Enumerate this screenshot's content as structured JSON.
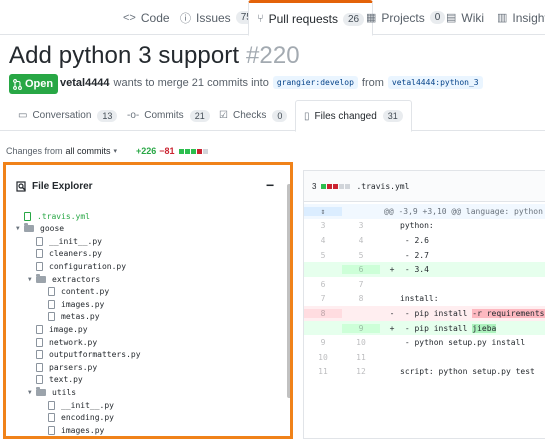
{
  "repo_nav": {
    "items": [
      {
        "icon": "code-icon",
        "glyph": "<>",
        "label": "Code",
        "count": null
      },
      {
        "icon": "issue-icon",
        "glyph": "ⓘ",
        "label": "Issues",
        "count": "75"
      },
      {
        "icon": "pull-request-icon",
        "glyph": "⑂",
        "label": "Pull requests",
        "count": "26"
      },
      {
        "icon": "projects-icon",
        "glyph": "▦",
        "label": "Projects",
        "count": "0"
      },
      {
        "icon": "wiki-icon",
        "glyph": "▤",
        "label": "Wiki",
        "count": null
      },
      {
        "icon": "insights-icon",
        "glyph": "▥",
        "label": "Insights",
        "count": null
      }
    ]
  },
  "pr": {
    "title": "Add python 3 support",
    "number": "#220",
    "state": "Open",
    "state_icon": "pr-open-icon",
    "author": "vetal4444",
    "action_text": "wants to merge 21 commits into",
    "base_branch": "grangier:develop",
    "from_text": "from",
    "head_branch": "vetal4444:python_3"
  },
  "tabs": [
    {
      "icon": "conversation-icon",
      "glyph": "▭",
      "label": "Conversation",
      "count": "13"
    },
    {
      "icon": "commits-icon",
      "glyph": "-o-",
      "label": "Commits",
      "count": "21"
    },
    {
      "icon": "checks-icon",
      "glyph": "☑",
      "label": "Checks",
      "count": "0"
    },
    {
      "icon": "files-changed-icon",
      "glyph": "▯",
      "label": "Files changed",
      "count": "31"
    }
  ],
  "changes": {
    "prefix": "Changes from",
    "selector": "all commits",
    "additions": "+226",
    "deletions": "−81"
  },
  "explorer": {
    "title": "File Explorer",
    "collapse": "−",
    "tree": [
      {
        "type": "file",
        "label": ".travis.yml",
        "depth": 0,
        "active": true
      },
      {
        "type": "folder",
        "label": "goose",
        "depth": 0
      },
      {
        "type": "file",
        "label": "__init__.py",
        "depth": 1
      },
      {
        "type": "file",
        "label": "cleaners.py",
        "depth": 1
      },
      {
        "type": "file",
        "label": "configuration.py",
        "depth": 1
      },
      {
        "type": "folder",
        "label": "extractors",
        "depth": 1
      },
      {
        "type": "file",
        "label": "content.py",
        "depth": 2
      },
      {
        "type": "file",
        "label": "images.py",
        "depth": 2
      },
      {
        "type": "file",
        "label": "metas.py",
        "depth": 2
      },
      {
        "type": "file",
        "label": "image.py",
        "depth": 1
      },
      {
        "type": "file",
        "label": "network.py",
        "depth": 1
      },
      {
        "type": "file",
        "label": "outputformatters.py",
        "depth": 1
      },
      {
        "type": "file",
        "label": "parsers.py",
        "depth": 1
      },
      {
        "type": "file",
        "label": "text.py",
        "depth": 1
      },
      {
        "type": "folder",
        "label": "utils",
        "depth": 1
      },
      {
        "type": "file",
        "label": "__init__.py",
        "depth": 2
      },
      {
        "type": "file",
        "label": "encoding.py",
        "depth": 2
      },
      {
        "type": "file",
        "label": "images.py",
        "depth": 2
      }
    ]
  },
  "diff": {
    "change_count": "3",
    "filename": ".travis.yml",
    "expand_icon": "unfold-icon",
    "lines": [
      {
        "kind": "hunk",
        "old": "",
        "new": "",
        "mark": "",
        "text": "@@ -3,9 +3,10 @@ language: python"
      },
      {
        "kind": "ctx",
        "old": "3",
        "new": "3",
        "mark": "",
        "text": "python:"
      },
      {
        "kind": "ctx",
        "old": "4",
        "new": "4",
        "mark": "",
        "text": "    - 2.6"
      },
      {
        "kind": "ctx",
        "old": "5",
        "new": "5",
        "mark": "",
        "text": "    - 2.7"
      },
      {
        "kind": "add",
        "old": "",
        "new": "6",
        "mark": "+",
        "text": "    - 3.4"
      },
      {
        "kind": "ctx",
        "old": "6",
        "new": "7",
        "mark": "",
        "text": ""
      },
      {
        "kind": "ctx",
        "old": "7",
        "new": "8",
        "mark": "",
        "text": "install:"
      },
      {
        "kind": "del",
        "old": "8",
        "new": "",
        "mark": "-",
        "text": "    - pip install ",
        "hl": "-r requirements.",
        "tail": ""
      },
      {
        "kind": "add",
        "old": "",
        "new": "9",
        "mark": "+",
        "text": "    - pip install ",
        "hl": "jieba",
        "tail": ""
      },
      {
        "kind": "ctx",
        "old": "9",
        "new": "10",
        "mark": "",
        "text": "    - python setup.py install"
      },
      {
        "kind": "ctx",
        "old": "10",
        "new": "11",
        "mark": "",
        "text": ""
      },
      {
        "kind": "ctx",
        "old": "11",
        "new": "12",
        "mark": "",
        "text": "script: python setup.py test"
      }
    ]
  }
}
